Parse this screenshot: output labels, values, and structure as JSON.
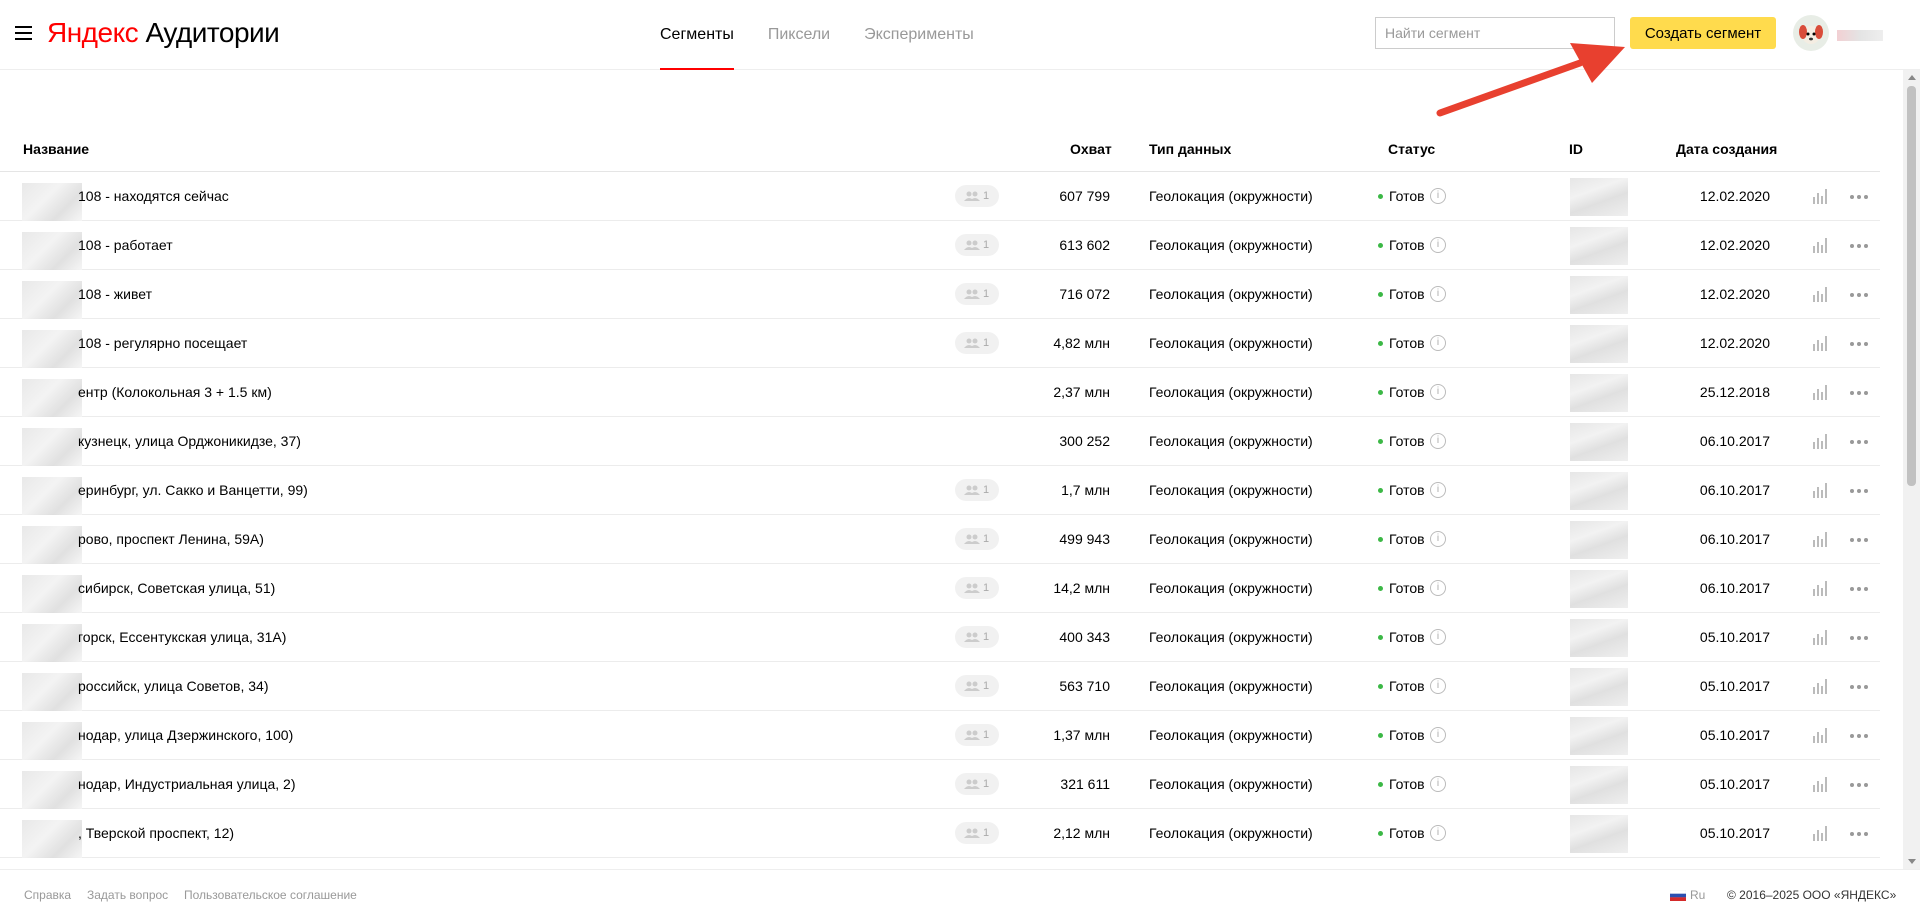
{
  "header": {
    "logo_brand": "Яндекс",
    "logo_product": "Аудитории",
    "tabs": [
      {
        "label": "Сегменты",
        "active": true
      },
      {
        "label": "Пиксели",
        "active": false
      },
      {
        "label": "Эксперименты",
        "active": false
      }
    ],
    "search_placeholder": "Найти сегмент",
    "create_label": "Создать сегмент",
    "accent_color": "#ffdb4d",
    "tab_underline_color": "#ff0000"
  },
  "table": {
    "columns": [
      "Название",
      "Охват",
      "Тип данных",
      "Статус",
      "ID",
      "Дата создания"
    ],
    "rows": [
      {
        "name": "108 - находятся сейчас",
        "shared": "1",
        "reach": "607 799",
        "type": "Геолокация (окружности)",
        "status": "Готов",
        "date": "12.02.2020"
      },
      {
        "name": "108 - работает",
        "shared": "1",
        "reach": "613 602",
        "type": "Геолокация (окружности)",
        "status": "Готов",
        "date": "12.02.2020"
      },
      {
        "name": "108 - живет",
        "shared": "1",
        "reach": "716 072",
        "type": "Геолокация (окружности)",
        "status": "Готов",
        "date": "12.02.2020"
      },
      {
        "name": "108 - регулярно посещает",
        "shared": "1",
        "reach": "4,82 млн",
        "type": "Геолокация (окружности)",
        "status": "Готов",
        "date": "12.02.2020"
      },
      {
        "name": "ентр (Колокольная 3 + 1.5 км)",
        "shared": "",
        "reach": "2,37 млн",
        "type": "Геолокация (окружности)",
        "status": "Готов",
        "date": "25.12.2018"
      },
      {
        "name": "кузнецк, улица Орджоникидзе, 37)",
        "shared": "",
        "reach": "300 252",
        "type": "Геолокация (окружности)",
        "status": "Готов",
        "date": "06.10.2017"
      },
      {
        "name": "еринбург, ул. Сакко и Ванцетти, 99)",
        "shared": "1",
        "reach": "1,7 млн",
        "type": "Геолокация (окружности)",
        "status": "Готов",
        "date": "06.10.2017"
      },
      {
        "name": "рово, проспект Ленина, 59А)",
        "shared": "1",
        "reach": "499 943",
        "type": "Геолокация (окружности)",
        "status": "Готов",
        "date": "06.10.2017"
      },
      {
        "name": "сибирск, Советская улица, 51)",
        "shared": "1",
        "reach": "14,2 млн",
        "type": "Геолокация (окружности)",
        "status": "Готов",
        "date": "06.10.2017"
      },
      {
        "name": "горск, Ессентукская улица, 31А)",
        "shared": "1",
        "reach": "400 343",
        "type": "Геолокация (окружности)",
        "status": "Готов",
        "date": "05.10.2017"
      },
      {
        "name": "российск, улица Советов, 34)",
        "shared": "1",
        "reach": "563 710",
        "type": "Геолокация (окружности)",
        "status": "Готов",
        "date": "05.10.2017"
      },
      {
        "name": "нодар, улица Дзержинского, 100)",
        "shared": "1",
        "reach": "1,37 млн",
        "type": "Геолокация (окружности)",
        "status": "Готов",
        "date": "05.10.2017"
      },
      {
        "name": "нодар, Индустриальная улица, 2)",
        "shared": "1",
        "reach": "321 611",
        "type": "Геолокация (окружности)",
        "status": "Готов",
        "date": "05.10.2017"
      },
      {
        "name": ", Тверской проспект, 12)",
        "shared": "1",
        "reach": "2,12 млн",
        "type": "Геолокация (окружности)",
        "status": "Готов",
        "date": "05.10.2017"
      }
    ]
  },
  "footer": {
    "links": [
      "Справка",
      "Задать вопрос",
      "Пользовательское соглашение"
    ],
    "lang": "Ru",
    "copyright": "© 2016–2025 ООО «ЯНДЕКС»"
  }
}
